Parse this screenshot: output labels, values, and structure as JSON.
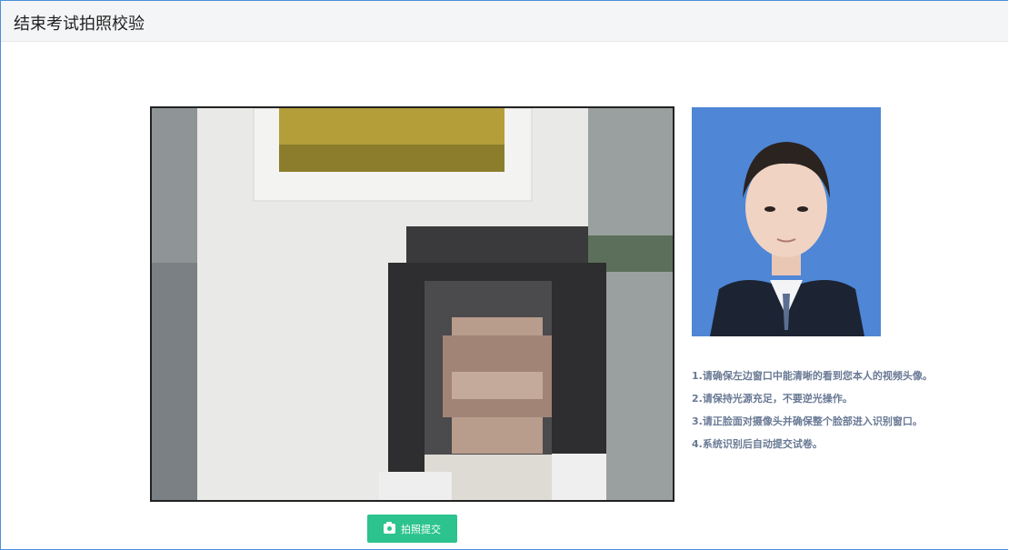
{
  "page": {
    "title": "结束考试拍照校验"
  },
  "instructions": [
    "1.请确保左边窗口中能清晰的看到您本人的视频头像。",
    "2.请保持光源充足，不要逆光操作。",
    "3.请正脸面对摄像头并确保整个脸部进入识别窗口。",
    "4.系统识别后自动提交试卷。"
  ],
  "actions": {
    "capture_label": "拍照提交",
    "capture_icon": "camera-icon"
  },
  "colors": {
    "accent": "#2cc38e",
    "frame_border": "#4a90d9",
    "instruction_text": "#6a7a95"
  }
}
